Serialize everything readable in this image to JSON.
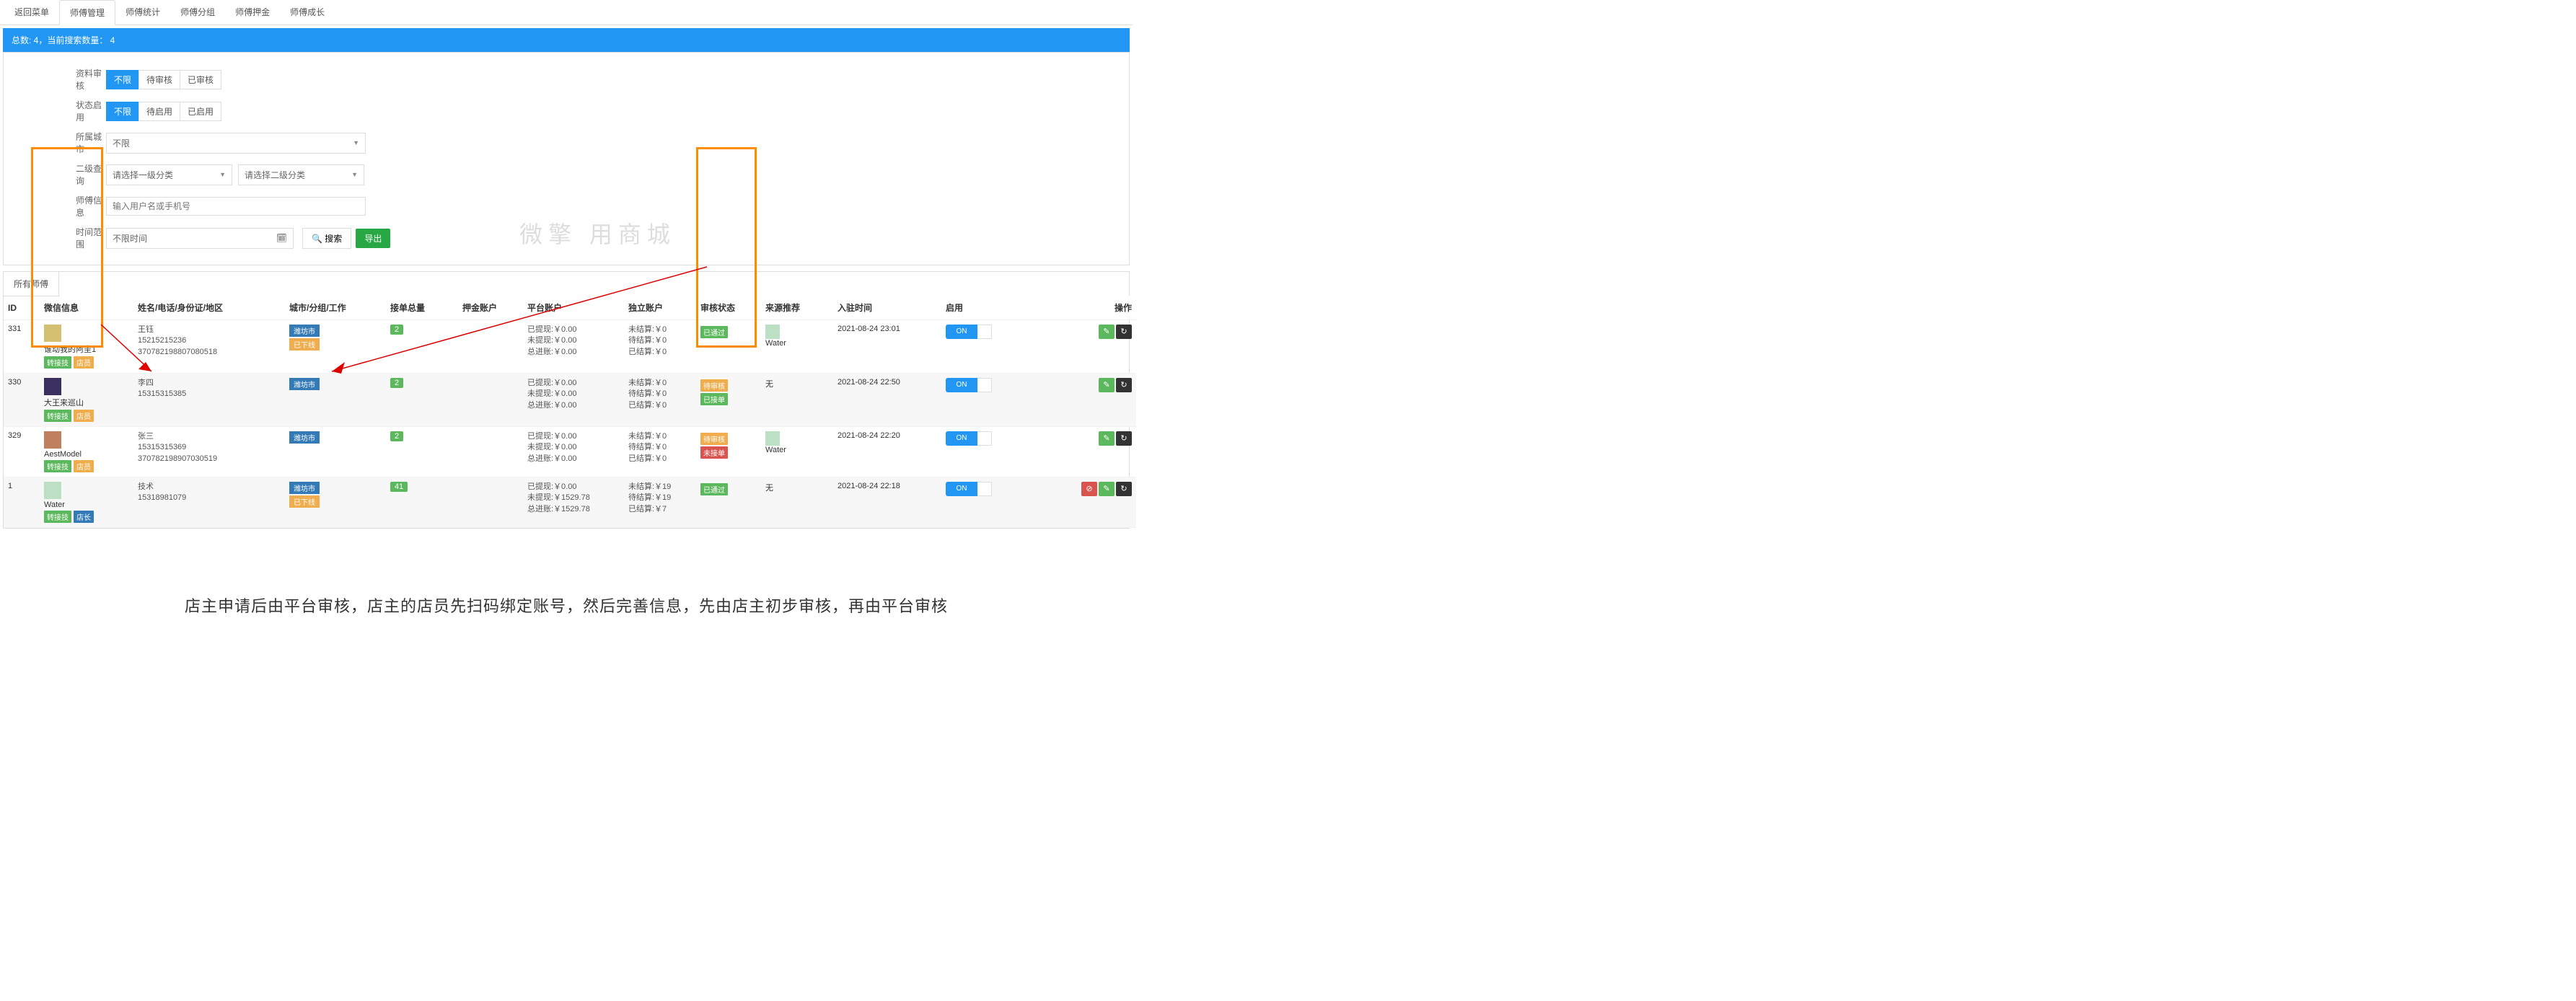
{
  "tabs": [
    "返回菜单",
    "师傅管理",
    "师傅统计",
    "师傅分组",
    "师傅押金",
    "师傅成长"
  ],
  "active_tab_index": 1,
  "summary": "总数: 4，当前搜索数量： 4",
  "filters": {
    "row1_label": "资料审核",
    "row1_opts": [
      "不限",
      "待审核",
      "已审核"
    ],
    "row1_active": 0,
    "row2_label": "状态启用",
    "row2_opts": [
      "不限",
      "待启用",
      "已启用"
    ],
    "row2_active": 0,
    "city_label": "所属城市",
    "city_value": "不限",
    "cat_label": "二级查询",
    "cat1_value": "请选择一级分类",
    "cat2_value": "请选择二级分类",
    "info_label": "师傅信息",
    "info_placeholder": "输入用户名或手机号",
    "time_label": "时间范围",
    "time_value": "不限时间",
    "search_btn": "搜索",
    "export_btn": "导出"
  },
  "subtab": "所有师傅",
  "columns": [
    "ID",
    "微信信息",
    "姓名/电话/身份证/地区",
    "城市/分组/工作",
    "接单总量",
    "押金账户",
    "平台账户",
    "独立账户",
    "审核状态",
    "来源推荐",
    "入驻时间",
    "启用",
    "操作"
  ],
  "rows": [
    {
      "id": "331",
      "wx_name": "谁动我的阿圭1",
      "wx_badges": [
        {
          "txt": "转接技",
          "cls": "badge-green"
        },
        {
          "txt": "店员",
          "cls": "badge-orange"
        }
      ],
      "name_lines": [
        "王钰",
        "15215215236",
        "370782198807080518"
      ],
      "city": "潍坊市",
      "city_tag2": "已下线",
      "orders": "2",
      "platform": [
        "已提现:￥0.00",
        "未提现:￥0.00",
        "总进账:￥0.00"
      ],
      "indep": [
        "未结算:￥0",
        "待结算:￥0",
        "已结算:￥0"
      ],
      "audits": [
        {
          "txt": "已通过",
          "cls": "badge-green"
        }
      ],
      "src_avatar": "a4",
      "src_name": "Water",
      "time": "2021-08-24 23:01",
      "toggle": "ON",
      "ops": [
        {
          "cls": "op-green",
          "icon": "✎"
        },
        {
          "cls": "op-dark",
          "icon": "↻"
        }
      ],
      "alt": false
    },
    {
      "id": "330",
      "wx_name": "大王来巡山",
      "wx_badges": [
        {
          "txt": "转接技",
          "cls": "badge-green"
        },
        {
          "txt": "店员",
          "cls": "badge-orange"
        }
      ],
      "name_lines": [
        "李四",
        "15315315385"
      ],
      "city": "潍坊市",
      "city_tag2": "",
      "orders": "2",
      "platform": [
        "已提现:￥0.00",
        "未提现:￥0.00",
        "总进账:￥0.00"
      ],
      "indep": [
        "未结算:￥0",
        "待结算:￥0",
        "已结算:￥0"
      ],
      "audits": [
        {
          "txt": "待审核",
          "cls": "badge-orange"
        },
        {
          "txt": "已接单",
          "cls": "badge-green"
        }
      ],
      "src_avatar": "",
      "src_name": "无",
      "time": "2021-08-24 22:50",
      "toggle": "ON",
      "ops": [
        {
          "cls": "op-green",
          "icon": "✎"
        },
        {
          "cls": "op-dark",
          "icon": "↻"
        }
      ],
      "alt": true
    },
    {
      "id": "329",
      "wx_name": "AestModel",
      "wx_badges": [
        {
          "txt": "转接技",
          "cls": "badge-green"
        },
        {
          "txt": "店员",
          "cls": "badge-orange"
        }
      ],
      "name_lines": [
        "张三",
        "15315315369",
        "370782198907030519"
      ],
      "city": "潍坊市",
      "city_tag2": "",
      "orders": "2",
      "platform": [
        "已提现:￥0.00",
        "未提现:￥0.00",
        "总进账:￥0.00"
      ],
      "indep": [
        "未结算:￥0",
        "待结算:￥0",
        "已结算:￥0"
      ],
      "audits": [
        {
          "txt": "待审核",
          "cls": "badge-orange"
        },
        {
          "txt": "未接单",
          "cls": "badge-red"
        }
      ],
      "src_avatar": "a4",
      "src_name": "Water",
      "time": "2021-08-24 22:20",
      "toggle": "ON",
      "ops": [
        {
          "cls": "op-green",
          "icon": "✎"
        },
        {
          "cls": "op-dark",
          "icon": "↻"
        }
      ],
      "alt": false
    },
    {
      "id": "1",
      "wx_name": "Water",
      "wx_badges": [
        {
          "txt": "转接技",
          "cls": "badge-green"
        },
        {
          "txt": "店长",
          "cls": "badge-blue"
        }
      ],
      "name_lines": [
        "技术",
        "15318981079"
      ],
      "city": "潍坊市",
      "city_tag2": "已下线",
      "orders": "41",
      "platform": [
        "已提现:￥0.00",
        "未提现:￥1529.78",
        "总进账:￥1529.78"
      ],
      "indep": [
        "未结算:￥19",
        "待结算:￥19",
        "已结算:￥7"
      ],
      "audits": [
        {
          "txt": "已通过",
          "cls": "badge-green"
        }
      ],
      "src_avatar": "",
      "src_name": "无",
      "time": "2021-08-24 22:18",
      "toggle": "ON",
      "ops": [
        {
          "cls": "op-red",
          "icon": "⊘"
        },
        {
          "cls": "op-green",
          "icon": "✎"
        },
        {
          "cls": "op-dark",
          "icon": "↻"
        }
      ],
      "alt": true
    }
  ],
  "watermark": "微擎    用商城",
  "caption": "店主申请后由平台审核，店主的店员先扫码绑定账号，然后完善信息，先由店主初步审核，再由平台审核"
}
